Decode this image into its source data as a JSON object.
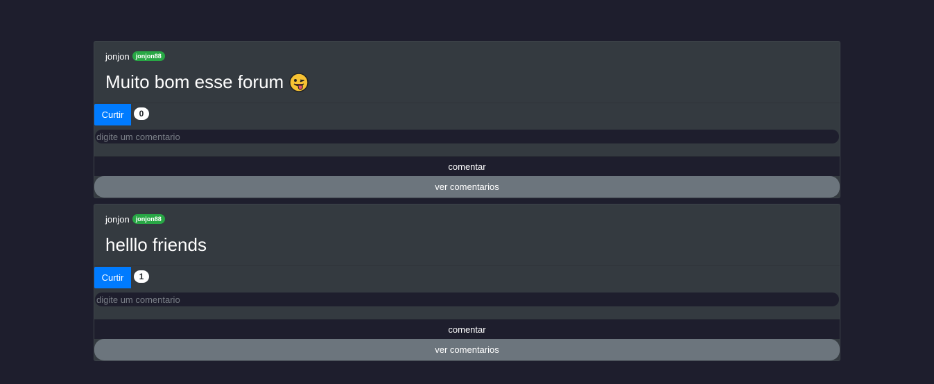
{
  "posts": [
    {
      "author": "jonjon",
      "username_badge": "jonjon88",
      "text": "Muito bom esse forum",
      "emoji": "😜",
      "like_label": "Curtir",
      "like_count": "0",
      "comment_placeholder": "digite um comentario",
      "comment_button": "comentar",
      "view_comments_button": "ver comentarios"
    },
    {
      "author": "jonjon",
      "username_badge": "jonjon88",
      "text": "helllo friends",
      "like_label": "Curtir",
      "like_count": "1",
      "comment_placeholder": "digite um comentario",
      "comment_button": "comentar",
      "view_comments_button": "ver comentarios"
    }
  ],
  "colors": {
    "background": "#1e1e2d",
    "card": "#343a40",
    "like_button": "#007bff",
    "badge": "#28a745",
    "view_button": "#6c757d"
  }
}
